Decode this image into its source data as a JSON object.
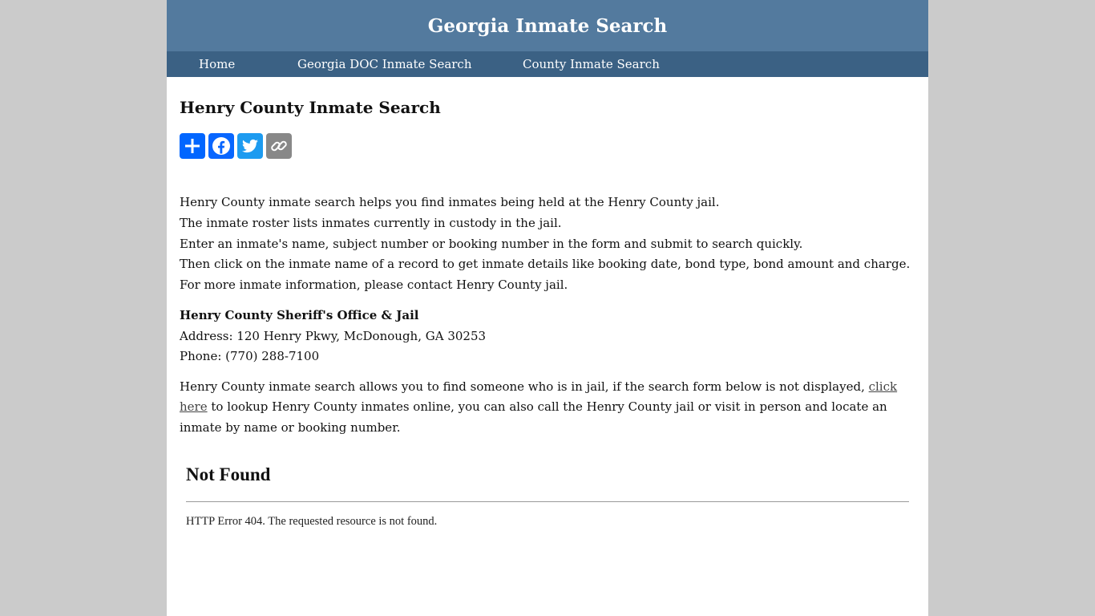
{
  "header": {
    "title": "Georgia Inmate Search"
  },
  "nav": [
    {
      "label": "Home"
    },
    {
      "label": "Georgia DOC Inmate Search"
    },
    {
      "label": "County Inmate Search"
    }
  ],
  "main": {
    "title": "Henry County Inmate Search",
    "share": [
      {
        "icon": "share-plus-icon",
        "color": "#0166ff"
      },
      {
        "icon": "facebook-icon",
        "color": "#0866ff"
      },
      {
        "icon": "twitter-icon",
        "color": "#1d9bf0"
      },
      {
        "icon": "copy-link-icon",
        "color": "#888888"
      }
    ],
    "intro": [
      "Henry County inmate search helps you find inmates being held at the Henry County jail.",
      "The inmate roster lists inmates currently in custody in the jail.",
      "Enter an inmate's name, subject number or booking number in the form and submit to search quickly.",
      "Then click on the inmate name of a record to get inmate details like booking date, bond type, bond amount and charge.",
      "For more inmate information, please contact Henry County jail."
    ],
    "office": {
      "name": "Henry County Sheriff's Office & Jail",
      "address": "Address: 120 Henry Pkwy, McDonough, GA 30253",
      "phone": "Phone: (770) 288-7100"
    },
    "lookup": {
      "before": "Henry County inmate search allows you to find someone who is in jail, if the search form below is not displayed, ",
      "link": "click here",
      "after": " to lookup Henry County inmates online, you can also call the Henry County jail or visit in person and locate an inmate by name or booking number."
    },
    "embed": {
      "title": "Not Found",
      "message": "HTTP Error 404. The requested resource is not found."
    }
  }
}
